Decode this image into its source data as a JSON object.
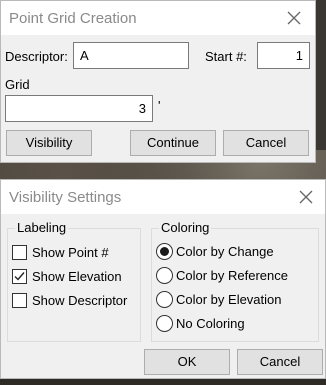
{
  "point_grid_dialog": {
    "title": "Point Grid Creation",
    "descriptor_label": "Descriptor:",
    "descriptor_value": "A",
    "start_label": "Start #:",
    "start_value": "1",
    "grid_label": "Grid",
    "grid_value": "3",
    "grid_unit": "'",
    "visibility_button": "Visibility",
    "continue_button": "Continue",
    "cancel_button": "Cancel"
  },
  "visibility_dialog": {
    "title": "Visibility Settings",
    "labeling": {
      "title": "Labeling",
      "options": [
        {
          "label": "Show Point #",
          "checked": false
        },
        {
          "label": "Show Elevation",
          "checked": true
        },
        {
          "label": "Show Descriptor",
          "checked": false
        }
      ]
    },
    "coloring": {
      "title": "Coloring",
      "options": [
        {
          "label": "Color by Change",
          "selected": true
        },
        {
          "label": "Color by Reference",
          "selected": false
        },
        {
          "label": "Color by Elevation",
          "selected": false
        },
        {
          "label": "No Coloring",
          "selected": false
        }
      ]
    },
    "ok_button": "OK",
    "cancel_button": "Cancel"
  },
  "icons": {
    "close": "close-icon",
    "check": "checkmark-icon"
  },
  "colors": {
    "title_text": "#8a8a8a",
    "dialog_bg": "#f0f0f0",
    "button_bg": "#e1e1e1"
  }
}
